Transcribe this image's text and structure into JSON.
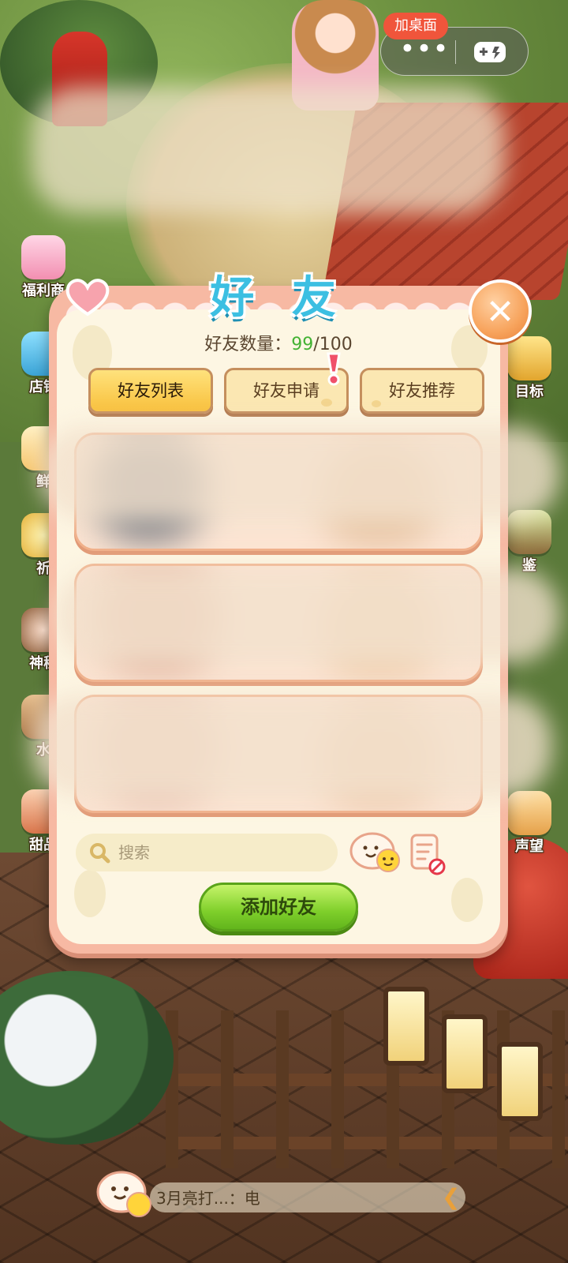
{
  "capsule": {
    "add_desktop_label": "加桌面",
    "more_glyph": "•••",
    "game_icon": "gamepad-icon"
  },
  "side_icons": {
    "left": [
      {
        "label": "福利商",
        "icon": "gift-shop-icon"
      },
      {
        "label": "店铺",
        "icon": "camera-icon"
      },
      {
        "label": "鲜",
        "icon": "fresh-icon"
      },
      {
        "label": "祈",
        "icon": "wish-icon"
      },
      {
        "label": "神秘",
        "icon": "mystery-npc-icon"
      },
      {
        "label": "水",
        "icon": "water-icon"
      },
      {
        "label": "甜品",
        "icon": "dessert-icon"
      }
    ],
    "right": [
      {
        "label": "目标",
        "icon": "goal-icon"
      },
      {
        "label": "鉴",
        "icon": "album-icon"
      },
      {
        "label": "声望",
        "icon": "reputation-icon"
      }
    ]
  },
  "modal": {
    "title": "好 友",
    "count_label": "好友数量：",
    "count_current": "99",
    "count_max": "/100",
    "tabs": [
      {
        "label": "好友列表",
        "active": true
      },
      {
        "label": "好友申请",
        "active": false,
        "alert": true
      },
      {
        "label": "好友推荐",
        "active": false
      }
    ],
    "search_placeholder": "搜索",
    "add_friend_label": "添加好友",
    "close_glyph": "✕"
  },
  "chat": {
    "preview_text": "3月亮打...：电",
    "arrow_glyph": "❮"
  },
  "colors": {
    "title": "#3cbfe2",
    "count_highlight": "#43b233",
    "tab_active": "#f8c03c",
    "add_button": "#7fcf2b",
    "close_button": "#f7a35c",
    "capsule_badge": "#f0553b"
  }
}
